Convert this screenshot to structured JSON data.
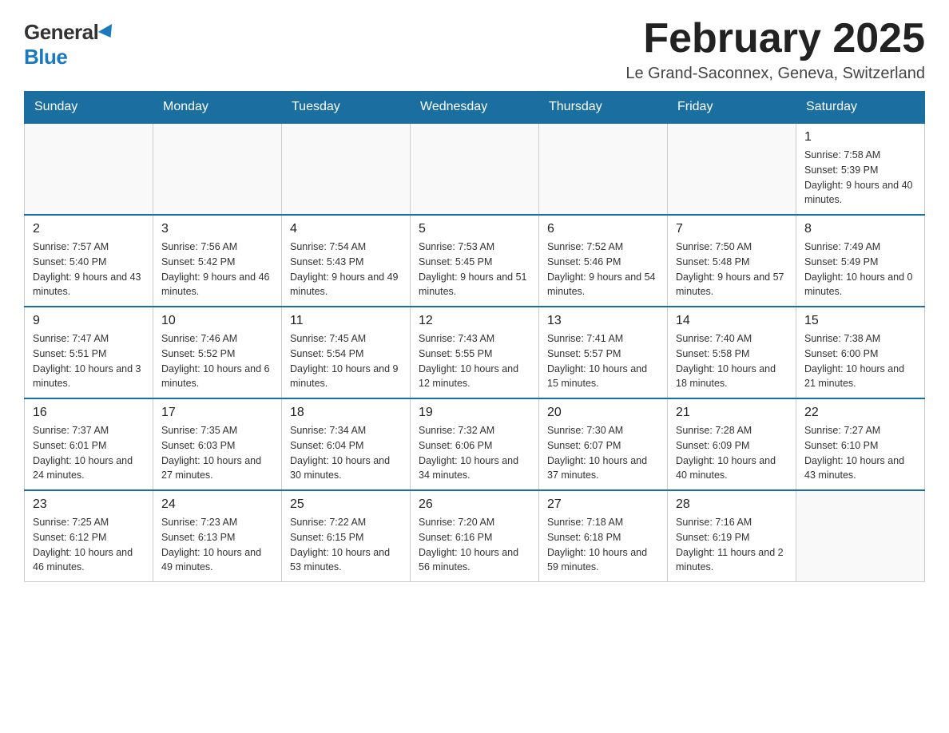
{
  "logo": {
    "general": "General",
    "blue": "Blue"
  },
  "title": "February 2025",
  "location": "Le Grand-Saconnex, Geneva, Switzerland",
  "headers": [
    "Sunday",
    "Monday",
    "Tuesday",
    "Wednesday",
    "Thursday",
    "Friday",
    "Saturday"
  ],
  "weeks": [
    [
      {
        "day": "",
        "sunrise": "",
        "sunset": "",
        "daylight": ""
      },
      {
        "day": "",
        "sunrise": "",
        "sunset": "",
        "daylight": ""
      },
      {
        "day": "",
        "sunrise": "",
        "sunset": "",
        "daylight": ""
      },
      {
        "day": "",
        "sunrise": "",
        "sunset": "",
        "daylight": ""
      },
      {
        "day": "",
        "sunrise": "",
        "sunset": "",
        "daylight": ""
      },
      {
        "day": "",
        "sunrise": "",
        "sunset": "",
        "daylight": ""
      },
      {
        "day": "1",
        "sunrise": "Sunrise: 7:58 AM",
        "sunset": "Sunset: 5:39 PM",
        "daylight": "Daylight: 9 hours and 40 minutes."
      }
    ],
    [
      {
        "day": "2",
        "sunrise": "Sunrise: 7:57 AM",
        "sunset": "Sunset: 5:40 PM",
        "daylight": "Daylight: 9 hours and 43 minutes."
      },
      {
        "day": "3",
        "sunrise": "Sunrise: 7:56 AM",
        "sunset": "Sunset: 5:42 PM",
        "daylight": "Daylight: 9 hours and 46 minutes."
      },
      {
        "day": "4",
        "sunrise": "Sunrise: 7:54 AM",
        "sunset": "Sunset: 5:43 PM",
        "daylight": "Daylight: 9 hours and 49 minutes."
      },
      {
        "day": "5",
        "sunrise": "Sunrise: 7:53 AM",
        "sunset": "Sunset: 5:45 PM",
        "daylight": "Daylight: 9 hours and 51 minutes."
      },
      {
        "day": "6",
        "sunrise": "Sunrise: 7:52 AM",
        "sunset": "Sunset: 5:46 PM",
        "daylight": "Daylight: 9 hours and 54 minutes."
      },
      {
        "day": "7",
        "sunrise": "Sunrise: 7:50 AM",
        "sunset": "Sunset: 5:48 PM",
        "daylight": "Daylight: 9 hours and 57 minutes."
      },
      {
        "day": "8",
        "sunrise": "Sunrise: 7:49 AM",
        "sunset": "Sunset: 5:49 PM",
        "daylight": "Daylight: 10 hours and 0 minutes."
      }
    ],
    [
      {
        "day": "9",
        "sunrise": "Sunrise: 7:47 AM",
        "sunset": "Sunset: 5:51 PM",
        "daylight": "Daylight: 10 hours and 3 minutes."
      },
      {
        "day": "10",
        "sunrise": "Sunrise: 7:46 AM",
        "sunset": "Sunset: 5:52 PM",
        "daylight": "Daylight: 10 hours and 6 minutes."
      },
      {
        "day": "11",
        "sunrise": "Sunrise: 7:45 AM",
        "sunset": "Sunset: 5:54 PM",
        "daylight": "Daylight: 10 hours and 9 minutes."
      },
      {
        "day": "12",
        "sunrise": "Sunrise: 7:43 AM",
        "sunset": "Sunset: 5:55 PM",
        "daylight": "Daylight: 10 hours and 12 minutes."
      },
      {
        "day": "13",
        "sunrise": "Sunrise: 7:41 AM",
        "sunset": "Sunset: 5:57 PM",
        "daylight": "Daylight: 10 hours and 15 minutes."
      },
      {
        "day": "14",
        "sunrise": "Sunrise: 7:40 AM",
        "sunset": "Sunset: 5:58 PM",
        "daylight": "Daylight: 10 hours and 18 minutes."
      },
      {
        "day": "15",
        "sunrise": "Sunrise: 7:38 AM",
        "sunset": "Sunset: 6:00 PM",
        "daylight": "Daylight: 10 hours and 21 minutes."
      }
    ],
    [
      {
        "day": "16",
        "sunrise": "Sunrise: 7:37 AM",
        "sunset": "Sunset: 6:01 PM",
        "daylight": "Daylight: 10 hours and 24 minutes."
      },
      {
        "day": "17",
        "sunrise": "Sunrise: 7:35 AM",
        "sunset": "Sunset: 6:03 PM",
        "daylight": "Daylight: 10 hours and 27 minutes."
      },
      {
        "day": "18",
        "sunrise": "Sunrise: 7:34 AM",
        "sunset": "Sunset: 6:04 PM",
        "daylight": "Daylight: 10 hours and 30 minutes."
      },
      {
        "day": "19",
        "sunrise": "Sunrise: 7:32 AM",
        "sunset": "Sunset: 6:06 PM",
        "daylight": "Daylight: 10 hours and 34 minutes."
      },
      {
        "day": "20",
        "sunrise": "Sunrise: 7:30 AM",
        "sunset": "Sunset: 6:07 PM",
        "daylight": "Daylight: 10 hours and 37 minutes."
      },
      {
        "day": "21",
        "sunrise": "Sunrise: 7:28 AM",
        "sunset": "Sunset: 6:09 PM",
        "daylight": "Daylight: 10 hours and 40 minutes."
      },
      {
        "day": "22",
        "sunrise": "Sunrise: 7:27 AM",
        "sunset": "Sunset: 6:10 PM",
        "daylight": "Daylight: 10 hours and 43 minutes."
      }
    ],
    [
      {
        "day": "23",
        "sunrise": "Sunrise: 7:25 AM",
        "sunset": "Sunset: 6:12 PM",
        "daylight": "Daylight: 10 hours and 46 minutes."
      },
      {
        "day": "24",
        "sunrise": "Sunrise: 7:23 AM",
        "sunset": "Sunset: 6:13 PM",
        "daylight": "Daylight: 10 hours and 49 minutes."
      },
      {
        "day": "25",
        "sunrise": "Sunrise: 7:22 AM",
        "sunset": "Sunset: 6:15 PM",
        "daylight": "Daylight: 10 hours and 53 minutes."
      },
      {
        "day": "26",
        "sunrise": "Sunrise: 7:20 AM",
        "sunset": "Sunset: 6:16 PM",
        "daylight": "Daylight: 10 hours and 56 minutes."
      },
      {
        "day": "27",
        "sunrise": "Sunrise: 7:18 AM",
        "sunset": "Sunset: 6:18 PM",
        "daylight": "Daylight: 10 hours and 59 minutes."
      },
      {
        "day": "28",
        "sunrise": "Sunrise: 7:16 AM",
        "sunset": "Sunset: 6:19 PM",
        "daylight": "Daylight: 11 hours and 2 minutes."
      },
      {
        "day": "",
        "sunrise": "",
        "sunset": "",
        "daylight": ""
      }
    ]
  ]
}
